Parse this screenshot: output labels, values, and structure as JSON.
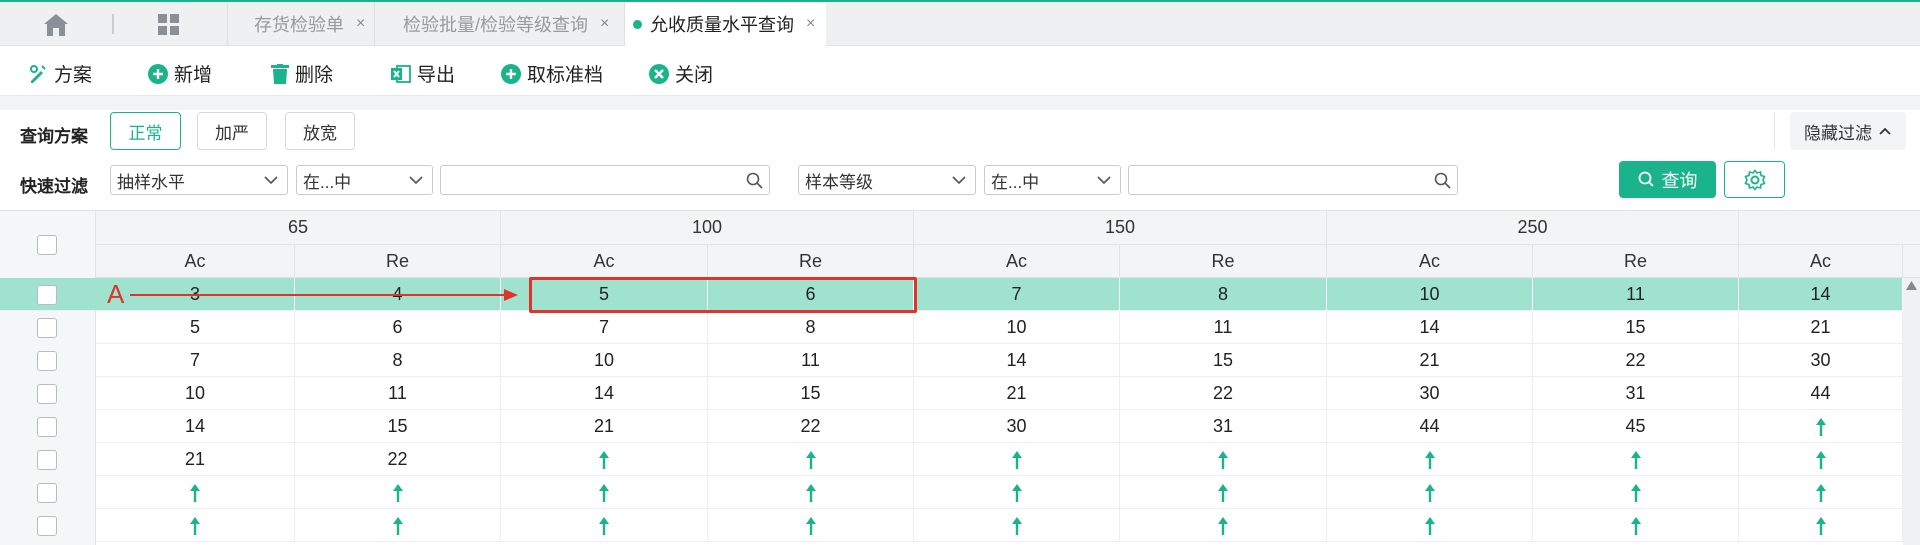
{
  "tabs": [
    {
      "label": "存货检验单",
      "close": "×"
    },
    {
      "label": "检验批量/检验等级查询",
      "close": "×"
    },
    {
      "label": "允收质量水平查询",
      "close": "×",
      "active": true
    }
  ],
  "toolbar": {
    "scheme": "方案",
    "add": "新增",
    "delete": "删除",
    "export": "导出",
    "cancel_std": "取标准档",
    "close": "关闭"
  },
  "filter": {
    "scheme_label": "查询方案",
    "scheme_options": [
      "正常",
      "加严",
      "放宽"
    ],
    "hide_filter": "隐藏过滤",
    "quick_label": "快速过滤",
    "field1": "抽样水平",
    "op1": "在...中",
    "field2": "样本等级",
    "op2": "在...中",
    "query": "查询"
  },
  "table": {
    "groups": [
      "65",
      "100",
      "150",
      "250"
    ],
    "subheaders": [
      "Ac",
      "Re",
      "Ac",
      "Re",
      "Ac",
      "Re",
      "Ac",
      "Re",
      "Ac"
    ],
    "rows": [
      [
        "3",
        "4",
        "5",
        "6",
        "7",
        "8",
        "10",
        "11",
        "14"
      ],
      [
        "5",
        "6",
        "7",
        "8",
        "10",
        "11",
        "14",
        "15",
        "21"
      ],
      [
        "7",
        "8",
        "10",
        "11",
        "14",
        "15",
        "21",
        "22",
        "30"
      ],
      [
        "10",
        "11",
        "14",
        "15",
        "21",
        "22",
        "30",
        "31",
        "44"
      ],
      [
        "14",
        "15",
        "21",
        "22",
        "30",
        "31",
        "44",
        "45",
        "↑"
      ],
      [
        "21",
        "22",
        "↑",
        "↑",
        "↑",
        "↑",
        "↑",
        "↑",
        "↑"
      ],
      [
        "↑",
        "↑",
        "↑",
        "↑",
        "↑",
        "↑",
        "↑",
        "↑",
        "↑"
      ],
      [
        "↑",
        "↑",
        "↑",
        "↑",
        "↑",
        "↑",
        "↑",
        "↑",
        "↑"
      ]
    ]
  },
  "annotation": {
    "label": "A",
    "color": "#e0332d"
  },
  "colors": {
    "accent": "#1ab38b",
    "highlight_row": "#9fe3cf"
  }
}
